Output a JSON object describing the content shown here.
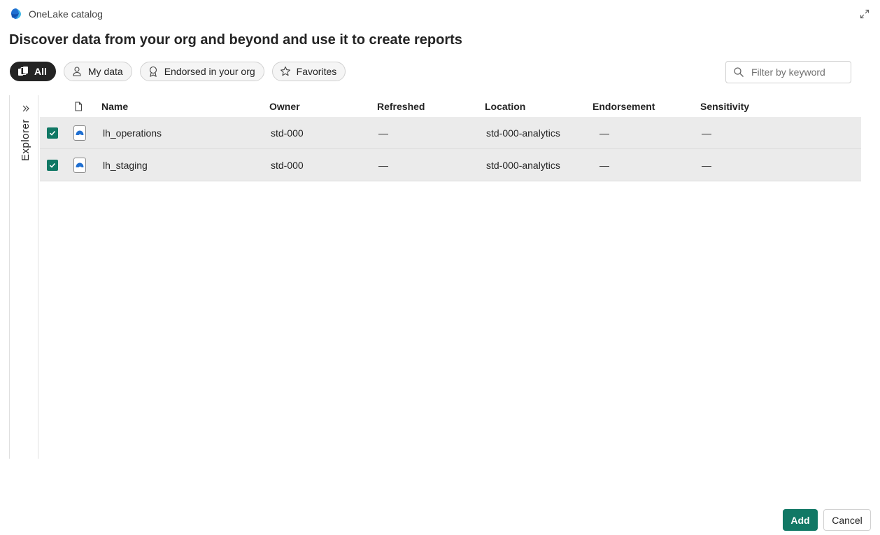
{
  "app": {
    "title": "OneLake catalog"
  },
  "headline": "Discover data from your org and beyond and use it to create reports",
  "filters": [
    {
      "label": "All",
      "icon": "stack-icon",
      "active": true
    },
    {
      "label": "My data",
      "icon": "person-icon",
      "active": false
    },
    {
      "label": "Endorsed in your org",
      "icon": "ribbon-icon",
      "active": false
    },
    {
      "label": "Favorites",
      "icon": "star-icon",
      "active": false
    }
  ],
  "search": {
    "placeholder": "Filter by keyword",
    "value": ""
  },
  "explorer": {
    "label": "Explorer"
  },
  "table": {
    "columns": [
      "Name",
      "Owner",
      "Refreshed",
      "Location",
      "Endorsement",
      "Sensitivity"
    ],
    "rows": [
      {
        "checked": true,
        "icon": "lakehouse-icon",
        "name": "lh_operations",
        "owner": "std-000",
        "refreshed": "—",
        "location": "std-000-analytics",
        "endorsement": "—",
        "sensitivity": "—"
      },
      {
        "checked": true,
        "icon": "lakehouse-icon",
        "name": "lh_staging",
        "owner": "std-000",
        "refreshed": "—",
        "location": "std-000-analytics",
        "endorsement": "—",
        "sensitivity": "—"
      }
    ]
  },
  "buttons": {
    "add": "Add",
    "cancel": "Cancel"
  },
  "colors": {
    "accent": "#117865",
    "chip_active": "#242424",
    "row_selected": "#ebebeb"
  }
}
